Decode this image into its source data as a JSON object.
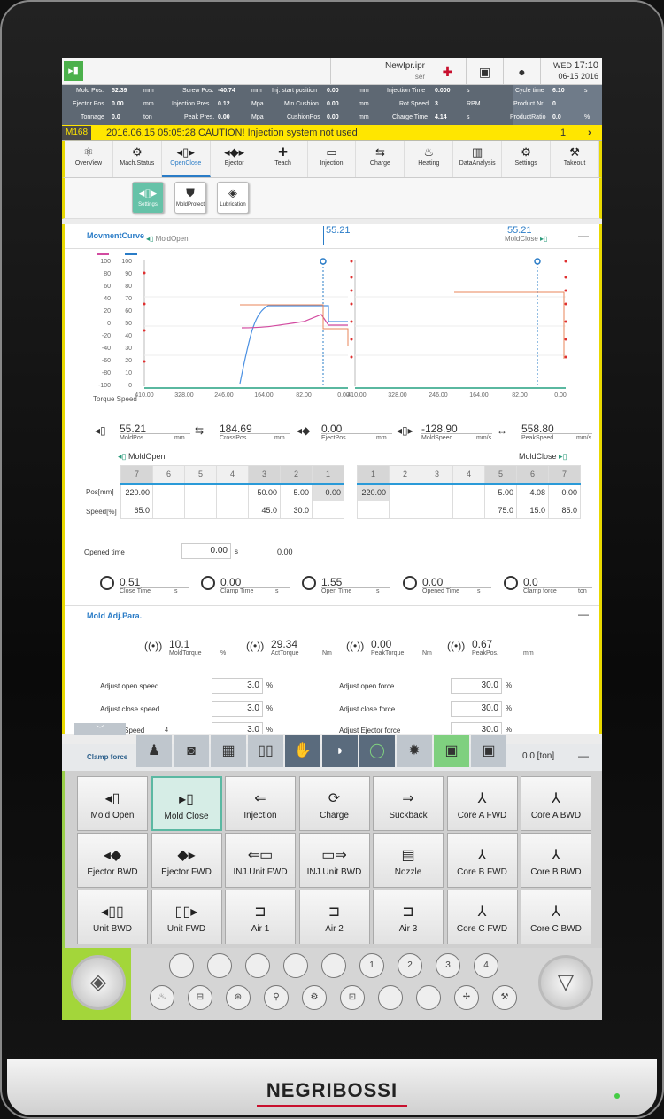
{
  "brand": "NEGRIBOSSI",
  "topbar": {
    "file": "NewIpr.ipr",
    "file_sub": "ser",
    "day": "WED",
    "time": "17:10",
    "date": "06-15 2016"
  },
  "status": {
    "r1": {
      "l1": "Mold Pos.",
      "v1": "52.39",
      "u1": "mm",
      "l2": "Screw Pos.",
      "v2": "-40.74",
      "u2": "mm",
      "l3": "Inj. start position",
      "v3": "0.00",
      "u3": "mm",
      "l4": "Injection Time",
      "v4": "0.000",
      "u4": "s"
    },
    "r2": {
      "l1": "Ejector Pos.",
      "v1": "0.00",
      "u1": "mm",
      "l2": "Injection Pres.",
      "v2": "0.12",
      "u2": "Mpa",
      "l3": "Min Cushion",
      "v3": "0.00",
      "u3": "mm",
      "l4": "Rot.Speed",
      "v4": "3",
      "u4": "RPM"
    },
    "r3": {
      "l1": "Tonnage",
      "v1": "0.0",
      "u1": "ton",
      "l2": "Peak Pres.",
      "v2": "0.00",
      "u2": "Mpa",
      "l3": "CushionPos",
      "v3": "0.00",
      "u3": "mm",
      "l4": "Charge Time",
      "v4": "4.14",
      "u4": "s"
    },
    "right": {
      "l1": "Cycle time",
      "v1": "6.10",
      "u1": "s",
      "l2": "Product Nr.",
      "v2": "0",
      "l3": "ProductRatio",
      "v3": "0.0",
      "u3": "%"
    }
  },
  "alarm": {
    "code": "M168",
    "text": "2016.06.15 05:05:28     CAUTION! Injection system not used",
    "count": "1"
  },
  "menu": [
    {
      "label": "OverView",
      "icon": "⚛"
    },
    {
      "label": "Mach.Status",
      "icon": "⚙"
    },
    {
      "label": "OpenClose",
      "icon": "◂▯▸"
    },
    {
      "label": "Ejector",
      "icon": "◂◆▸"
    },
    {
      "label": "Teach",
      "icon": "✚"
    },
    {
      "label": "Injection",
      "icon": "▭"
    },
    {
      "label": "Charge",
      "icon": "⇆"
    },
    {
      "label": "Heating",
      "icon": "♨"
    },
    {
      "label": "DataAnalysis",
      "icon": "▥"
    },
    {
      "label": "Settings",
      "icon": "⚙"
    },
    {
      "label": "Takeout",
      "icon": "⚒"
    }
  ],
  "submenu": [
    {
      "label": "Settings",
      "icon": "◂▯▸"
    },
    {
      "label": "MoldProtect",
      "icon": "⛊"
    },
    {
      "label": "Lubrication",
      "icon": "◈"
    }
  ],
  "curve": {
    "title": "MovmentCurve",
    "open": "MoldOpen",
    "close": "MoldClose",
    "pos_left": "55.21",
    "pos_right": "55.21",
    "legend": "Torque Speed"
  },
  "chart_data": {
    "type": "line",
    "left_axis_ticks": [
      "100",
      "80",
      "60",
      "40",
      "20",
      "0",
      "-20",
      "-40",
      "-60",
      "-80",
      "-100"
    ],
    "right_axis_ticks": [
      "100",
      "90",
      "80",
      "70",
      "60",
      "50",
      "40",
      "30",
      "20",
      "10",
      "0"
    ],
    "x_ticks_open": [
      "410.00",
      "328.00",
      "246.00",
      "164.00",
      "82.00",
      "0.00"
    ],
    "x_ticks_close": [
      "410.00",
      "328.00",
      "246.00",
      "164.00",
      "82.00",
      "0.00"
    ],
    "ylim": [
      -100,
      100
    ]
  },
  "readouts": [
    {
      "v": "55.21",
      "lab": "MoldPos.",
      "unit": "mm"
    },
    {
      "v": "184.69",
      "lab": "CrossPos.",
      "unit": "mm"
    },
    {
      "v": "0.00",
      "lab": "EjectPos.",
      "unit": "mm"
    },
    {
      "v": "-128.90",
      "lab": "MoldSpeed",
      "unit": "mm/s"
    },
    {
      "v": "558.80",
      "lab": "PeakSpeed",
      "unit": "mm/s"
    }
  ],
  "open_table": {
    "title": "MoldOpen",
    "steps": [
      "7",
      "6",
      "5",
      "4",
      "3",
      "2",
      "1"
    ],
    "pos": [
      "220.00",
      "",
      "",
      "",
      "50.00",
      "5.00",
      "0.00"
    ],
    "speed": [
      "65.0",
      "",
      "",
      "",
      "45.0",
      "30.0",
      ""
    ]
  },
  "close_table": {
    "title": "MoldClose",
    "steps": [
      "1",
      "2",
      "3",
      "4",
      "5",
      "6",
      "7"
    ],
    "pos": [
      "220.00",
      "",
      "",
      "",
      "5.00",
      "4.08",
      "0.00"
    ],
    "speed": [
      "",
      "",
      "",
      "",
      "75.0",
      "15.0",
      "85.0"
    ]
  },
  "row_labels": {
    "pos": "Pos[mm]",
    "speed": "Speed[%]"
  },
  "opened": {
    "label": "Opened time",
    "value": "0.00",
    "unit": "s",
    "extra": "0.00"
  },
  "timers": [
    {
      "v": "0.51",
      "lab": "Close Time",
      "unit": "s"
    },
    {
      "v": "0.00",
      "lab": "Clamp Time",
      "unit": "s"
    },
    {
      "v": "1.55",
      "lab": "Open Time",
      "unit": "s"
    },
    {
      "v": "0.00",
      "lab": "Opened Time",
      "unit": "s"
    },
    {
      "v": "0.0",
      "lab": "Clamp force",
      "unit": "ton"
    }
  ],
  "adj": {
    "title": "Mold Adj.Para.",
    "items": [
      {
        "v": "10.1",
        "lab": "MoldTorque",
        "unit": "%"
      },
      {
        "v": "29.34",
        "lab": "ActTorque",
        "unit": "Nm"
      },
      {
        "v": "0.00",
        "lab": "PeakTorque",
        "unit": "Nm"
      },
      {
        "v": "0.67",
        "lab": "PeakPos.",
        "unit": "mm"
      }
    ]
  },
  "params": [
    {
      "lab": "Adjust open speed",
      "v": "3.0",
      "u": "%"
    },
    {
      "lab": "Adjust close speed",
      "v": "3.0",
      "u": "%"
    },
    {
      "lab": "Adjust open force",
      "v": "30.0",
      "u": "%"
    },
    {
      "lab": "Adjust close force",
      "v": "30.0",
      "u": "%"
    },
    {
      "lab": "Ejector Speed",
      "v": "3.0",
      "u": "%"
    },
    {
      "lab": "Adjust Ejector force",
      "v": "30.0",
      "u": "%"
    }
  ],
  "clamp": {
    "label": "Clamp force",
    "value": "0.0 [ton]"
  },
  "dock": {
    "badge": "4"
  },
  "keys": [
    {
      "label": "Mold Open",
      "icon": "◂▯"
    },
    {
      "label": "Mold Close",
      "icon": "▸▯"
    },
    {
      "label": "Injection",
      "icon": "⇐"
    },
    {
      "label": "Charge",
      "icon": "⟳"
    },
    {
      "label": "Suckback",
      "icon": "⇒"
    },
    {
      "label": "Core A FWD",
      "icon": "⅄"
    },
    {
      "label": "Core A BWD",
      "icon": "⅄"
    },
    {
      "label": "Ejector BWD",
      "icon": "◂◆"
    },
    {
      "label": "Ejector FWD",
      "icon": "◆▸"
    },
    {
      "label": "INJ.Unit FWD",
      "icon": "⇐▭"
    },
    {
      "label": "INJ.Unit BWD",
      "icon": "▭⇒"
    },
    {
      "label": "Nozzle",
      "icon": "▤"
    },
    {
      "label": "Core B FWD",
      "icon": "⅄"
    },
    {
      "label": "Core B BWD",
      "icon": "⅄"
    },
    {
      "label": "Unit BWD",
      "icon": "◂▯▯"
    },
    {
      "label": "Unit FWD",
      "icon": "▯▯▸"
    },
    {
      "label": "Air 1",
      "icon": "⊐"
    },
    {
      "label": "Air 2",
      "icon": "⊐"
    },
    {
      "label": "Air 3",
      "icon": "⊐"
    },
    {
      "label": "Core C FWD",
      "icon": "⅄"
    },
    {
      "label": "Core C BWD",
      "icon": "⅄"
    }
  ],
  "round_top": [
    "",
    "",
    "",
    "",
    "",
    "1",
    "2",
    "3",
    "4"
  ],
  "round_bottom": [
    "♨",
    "⊟",
    "⊛",
    "⚲",
    "⚙",
    "⊡",
    "",
    "",
    "✢",
    "⚒"
  ]
}
